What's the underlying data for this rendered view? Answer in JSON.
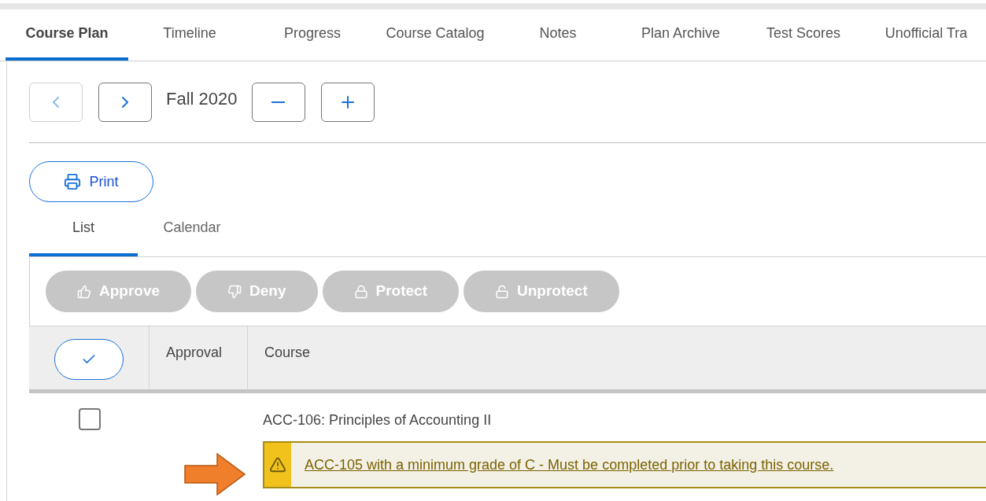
{
  "tabs": [
    {
      "label": "Course Plan",
      "selected": true
    },
    {
      "label": "Timeline",
      "selected": false
    },
    {
      "label": "Progress",
      "selected": false
    },
    {
      "label": "Course Catalog",
      "selected": false
    },
    {
      "label": "Notes",
      "selected": false
    },
    {
      "label": "Plan Archive",
      "selected": false
    },
    {
      "label": "Test Scores",
      "selected": false
    },
    {
      "label": "Unofficial Tra",
      "selected": false
    }
  ],
  "term_nav": {
    "previous_disabled": true,
    "next_disabled": false,
    "term": "Fall 2020"
  },
  "print_button": "Print",
  "view_tabs": [
    {
      "label": "List",
      "selected": true
    },
    {
      "label": "Calendar",
      "selected": false
    }
  ],
  "actions": [
    {
      "kind": "approve",
      "label": "Approve",
      "disabled": true
    },
    {
      "kind": "deny",
      "label": "Deny",
      "disabled": true
    },
    {
      "kind": "protect",
      "label": "Protect",
      "disabled": true
    },
    {
      "kind": "unprotect",
      "label": "Unprotect",
      "disabled": true
    }
  ],
  "table": {
    "columns": [
      "Approval",
      "Course"
    ],
    "rows": [
      {
        "checked": false,
        "course": "ACC-106: Principles of Accounting II",
        "warning": "ACC-105 with a minimum grade of C - Must be completed prior to taking this course."
      }
    ]
  }
}
